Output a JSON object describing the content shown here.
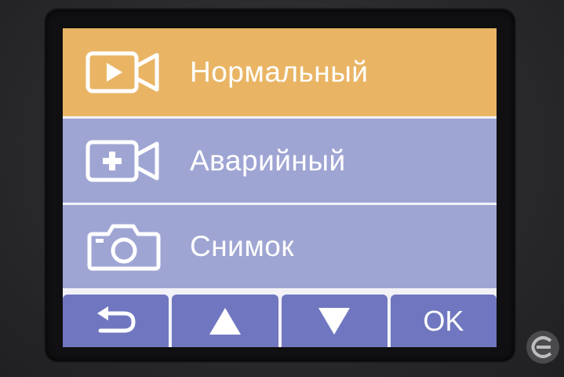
{
  "colors": {
    "selected_bg": "#e9b565",
    "item_bg": "#9fa5d3",
    "softkey_bg": "#7077c0",
    "text": "#ffffff",
    "divider": "#f2f2f8"
  },
  "menu": {
    "items": [
      {
        "label": "Нормальный",
        "icon": "video-play-icon",
        "selected": true
      },
      {
        "label": "Аварийный",
        "icon": "video-emergency-icon",
        "selected": false
      },
      {
        "label": "Снимок",
        "icon": "camera-icon",
        "selected": false
      }
    ]
  },
  "softkeys": [
    {
      "icon": "back-arrow-icon",
      "label": ""
    },
    {
      "icon": "up-arrow-icon",
      "label": ""
    },
    {
      "icon": "down-arrow-icon",
      "label": ""
    },
    {
      "icon": "",
      "label": "OK"
    }
  ]
}
